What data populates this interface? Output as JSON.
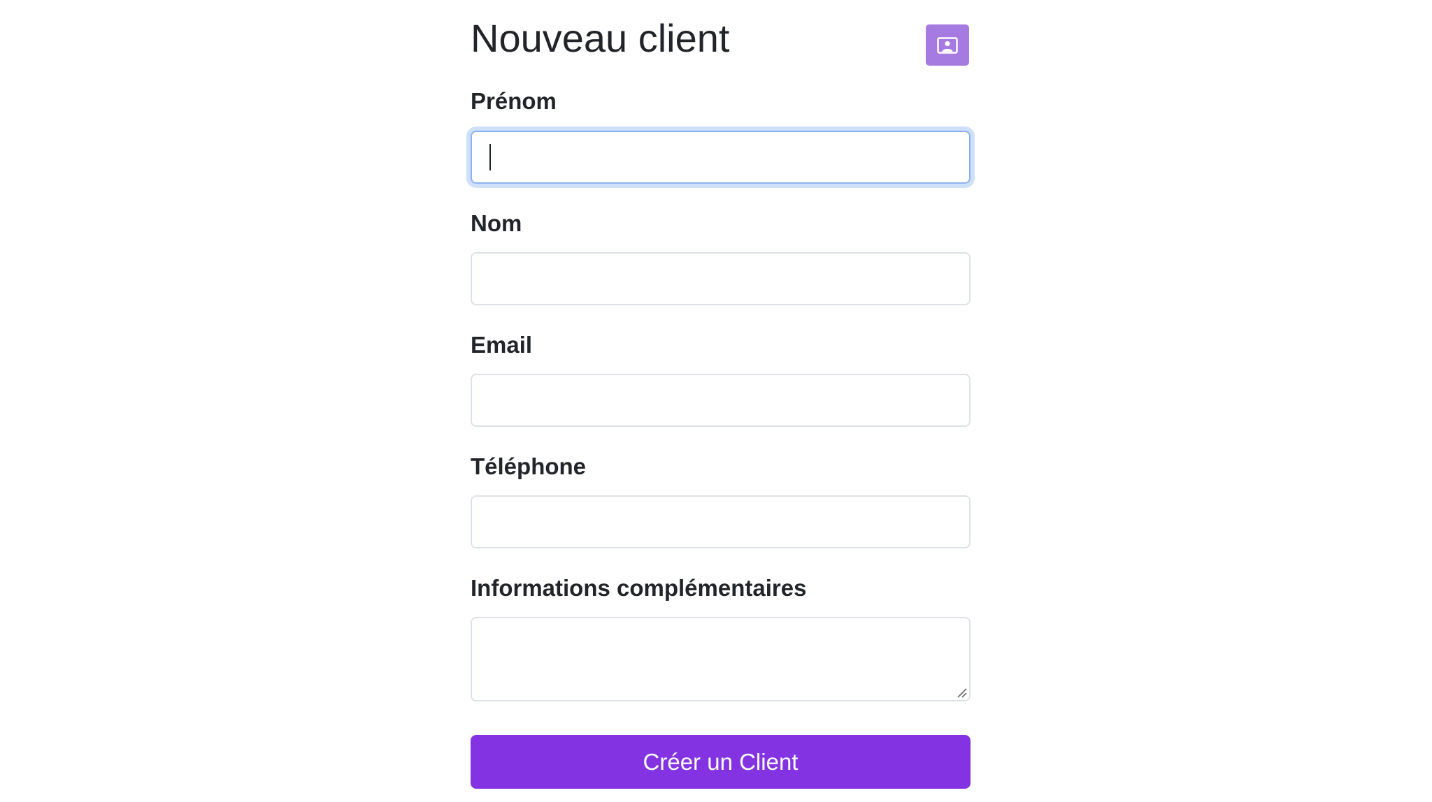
{
  "header": {
    "title": "Nouveau client",
    "contact_icon": "contact-card-icon",
    "button_color": "#a57be2"
  },
  "form": {
    "fields": [
      {
        "label": "Prénom",
        "value": "",
        "placeholder": "",
        "focused": true
      },
      {
        "label": "Nom",
        "value": "",
        "placeholder": ""
      },
      {
        "label": "Email",
        "value": "",
        "placeholder": ""
      },
      {
        "label": "Téléphone",
        "value": "",
        "placeholder": ""
      },
      {
        "label": "Informations complémentaires",
        "value": "",
        "placeholder": ""
      }
    ],
    "submit_label": "Créer un Client",
    "submit_color": "#8433e2",
    "focus_color": "#8eb2f1"
  }
}
